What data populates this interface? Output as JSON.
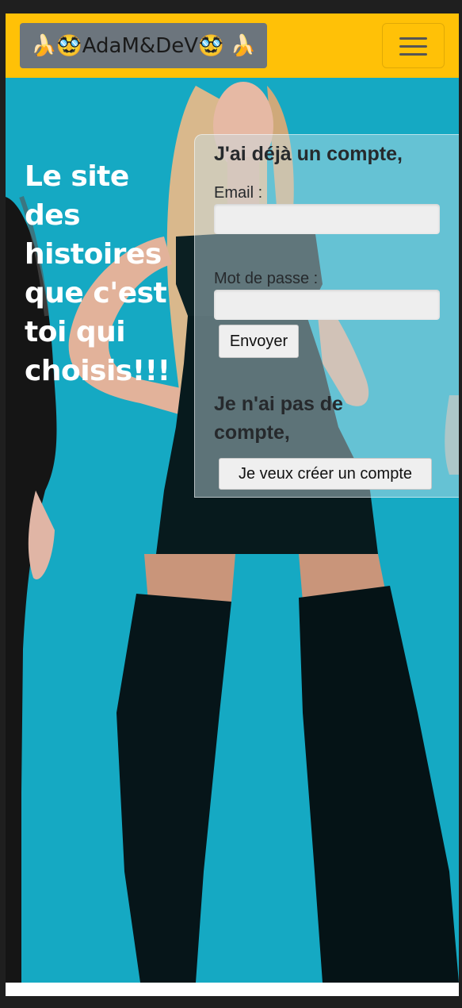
{
  "navbar": {
    "brand": "🍌🥸AdaM&DeV🥸 🍌",
    "toggle_icon": "hamburger-menu-icon",
    "background_color": "#ffc107",
    "brand_background_color": "#6c757d"
  },
  "hero": {
    "headline": "Le site des histoires que c'est toi qui choisis!!!",
    "background_color": "#15a9c3"
  },
  "login": {
    "title": "J'ai déjà un compte,",
    "email_label": "Email :",
    "email_value": "",
    "password_label": "Mot de passe :",
    "password_value": "",
    "submit_label": "Envoyer"
  },
  "signup": {
    "title": "Je n'ai pas de compte,",
    "button_label": "Je veux créer un compte"
  }
}
